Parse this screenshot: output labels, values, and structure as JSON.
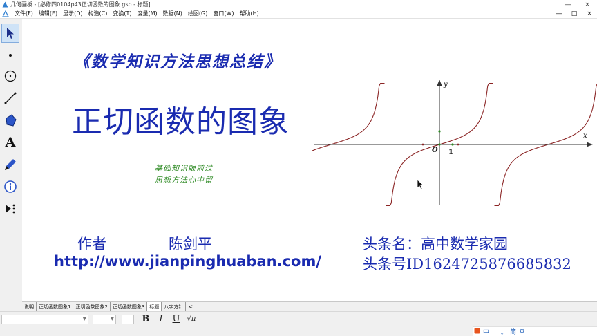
{
  "window": {
    "title": "几何画板 - [必修四0104p43正切函数的图象.gsp - 标题]",
    "buttons": {
      "minimize": "—",
      "close": "×"
    }
  },
  "menu": {
    "items": [
      "文件(F)",
      "编辑(E)",
      "显示(D)",
      "构造(C)",
      "变换(T)",
      "度量(M)",
      "数据(N)",
      "绘图(G)",
      "窗口(W)",
      "帮助(H)"
    ],
    "right_controls": [
      "—",
      "□",
      "×"
    ]
  },
  "toolbox": {
    "tools": [
      {
        "name": "arrow-select",
        "icon": "arrow-cursor-icon",
        "active": true
      },
      {
        "name": "point",
        "icon": "point-icon"
      },
      {
        "name": "compass",
        "icon": "circle-icon"
      },
      {
        "name": "straightedge",
        "icon": "line-segment-icon"
      },
      {
        "name": "polygon",
        "icon": "polygon-icon"
      },
      {
        "name": "text",
        "icon": "text-a-icon",
        "glyph": "A"
      },
      {
        "name": "marker",
        "icon": "marker-pen-icon"
      },
      {
        "name": "information",
        "icon": "info-icon"
      },
      {
        "name": "custom",
        "icon": "custom-tool-icon"
      }
    ]
  },
  "canvas": {
    "subtitle": "《数学知识方法思想总结》",
    "title": "正切函数的图象",
    "motto_line1": "基础知识眼前过",
    "motto_line2": "思想方法心中留",
    "author_label": "作者",
    "author_name": "陈剑平",
    "url": "http://www.jianpinghuaban.com/",
    "toutiao_name": "头条名：高中数学家园",
    "toutiao_id": "头条号ID1624725876685832",
    "graph": {
      "x_axis_label": "x",
      "y_axis_label": "y",
      "origin_label": "O",
      "unit_label": "1",
      "curve_color": "#8b2525",
      "axis_color": "#333333",
      "point_color": "#2e8a24"
    }
  },
  "chart_data": {
    "type": "line",
    "function": "y = tan(x)",
    "x_range": [
      -7.4,
      7.4
    ],
    "branch_count": 5,
    "asymptotes_x": [
      -4.712,
      -1.571,
      1.571,
      4.712
    ],
    "period": 3.1416
  },
  "tabs": [
    "说明",
    "正切函数图象1",
    "正切函数图象2",
    "正切函数图象3",
    "标题",
    "八字方针"
  ],
  "selected_tab": "标题",
  "tab_scroll": "<",
  "formatbar": {
    "bold": "B",
    "italic": "I",
    "underline": "U",
    "symbol": "√π"
  },
  "ime": [
    "中",
    "·",
    "。",
    "简",
    "⚙"
  ],
  "colors": {
    "title_blue": "#1a2bb0",
    "motto_green": "#2e8a24",
    "curve_red": "#8b2525"
  }
}
